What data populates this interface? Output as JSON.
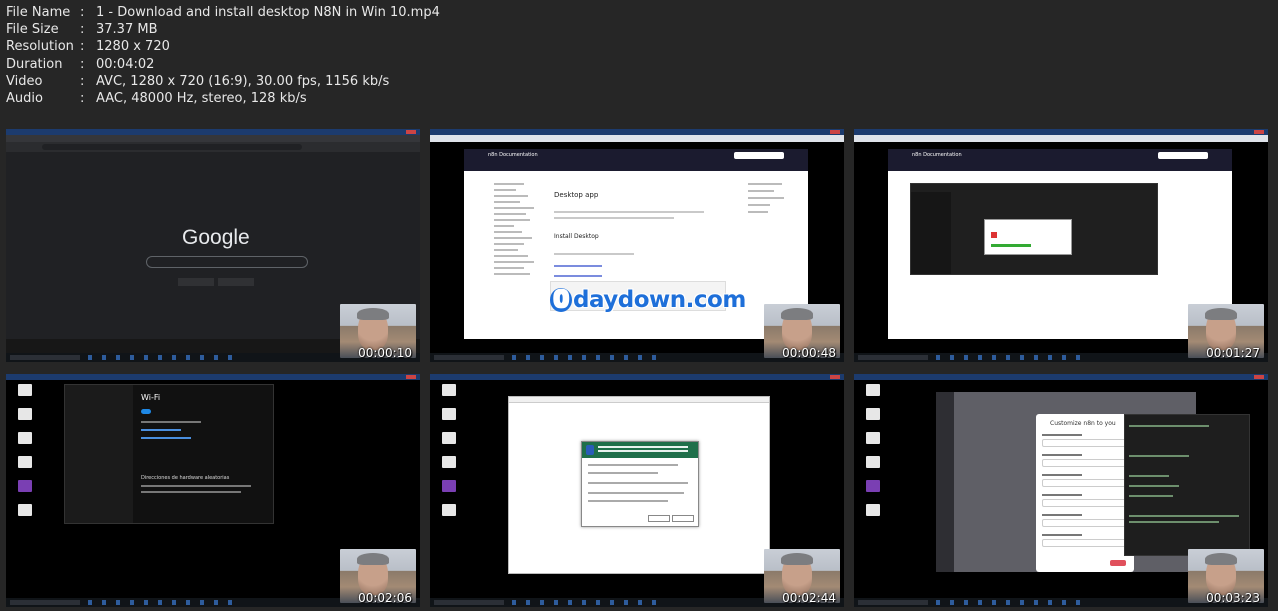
{
  "info": [
    {
      "key": "File Name",
      "value": "1 - Download and install desktop N8N in Win 10.mp4"
    },
    {
      "key": "File Size",
      "value": "37.37 MB"
    },
    {
      "key": "Resolution",
      "value": "1280 x 720"
    },
    {
      "key": "Duration",
      "value": "00:04:02"
    },
    {
      "key": "Video",
      "value": "AVC, 1280 x 720 (16:9), 30.00 fps, 1156 kb/s"
    },
    {
      "key": "Audio",
      "value": "AAC, 48000 Hz, stereo, 128 kb/s"
    }
  ],
  "separator": ":",
  "thumbnails": [
    {
      "timecode": "00:00:10",
      "logo": "Google"
    },
    {
      "timecode": "00:00:48",
      "brand": "n8n Documentation",
      "title": "Desktop app",
      "subtitle": "Install Desktop",
      "watermark_zero": "0",
      "watermark_rest": "daydown.com"
    },
    {
      "timecode": "00:01:27",
      "brand": "n8n Documentation"
    },
    {
      "timecode": "00:02:06",
      "title": "Wi-Fi",
      "section": "Direcciones de hardware aleatorias"
    },
    {
      "timecode": "00:02:44"
    },
    {
      "timecode": "00:03:23",
      "title": "Customize n8n to you"
    }
  ],
  "colors": {
    "background": "#262626",
    "text": "#e8e8e8",
    "watermark": "#1e6fd9"
  }
}
